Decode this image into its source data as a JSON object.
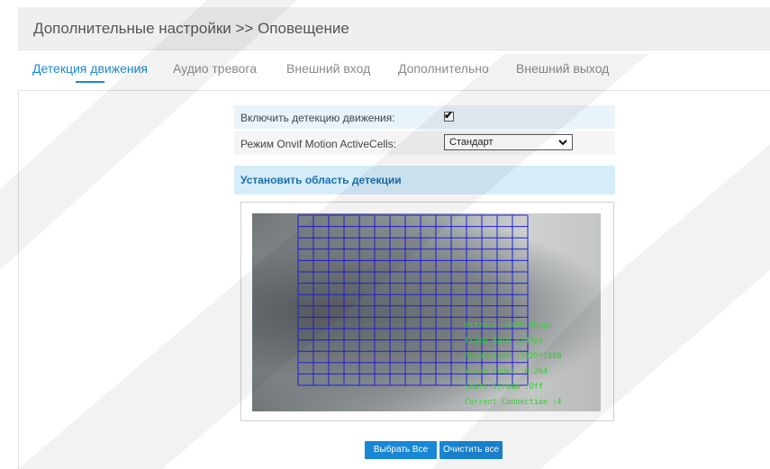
{
  "header": {
    "title": "Дополнительные настройки >> Оповещение"
  },
  "tabs": [
    {
      "label": "Детекция движения",
      "active": true
    },
    {
      "label": "Аудио тревога",
      "active": false
    },
    {
      "label": "Внешний вход",
      "active": false
    },
    {
      "label": "Дополнительно",
      "active": false
    },
    {
      "label": "Внешний выход",
      "active": false
    }
  ],
  "settings": {
    "enable_label": "Включить детекцию движения:",
    "enable_checked": true,
    "mode_label": "Режим Onvif Motion ActiveCells:",
    "mode_value": "Стандарт"
  },
  "detection_area": {
    "title": "Установить область детекции",
    "grid": {
      "columns": 15,
      "rows": 15
    }
  },
  "osd": {
    "bitrate": "Bitrate :4429.9kbps",
    "frame_rate": "Frame Rate :24fps",
    "resolution": "Resolution :1920*1080",
    "video_codec": "Video Codec :H.264",
    "smart_stream": "Smart Stream :Off",
    "connection": "Current Connection :4"
  },
  "buttons": {
    "select_all": "Выбрать Все",
    "clear_all": "Очистить все"
  },
  "colors": {
    "accent": "#1a87d6",
    "grid_line": "#1f1fd6",
    "osd_text": "#31d431"
  }
}
